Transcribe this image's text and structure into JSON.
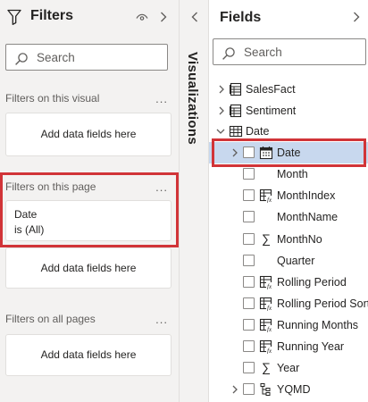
{
  "filters": {
    "title": "Filters",
    "search_placeholder": "Search",
    "this_visual": {
      "label": "Filters on this visual",
      "more": "...",
      "well": "Add data fields here"
    },
    "this_page": {
      "label": "Filters on this page",
      "more": "...",
      "card_field": "Date",
      "card_value": "is (All)",
      "well": "Add data fields here"
    },
    "all_pages": {
      "label": "Filters on all pages",
      "more": "...",
      "well": "Add data fields here"
    }
  },
  "visualizations": {
    "label": "Visualizations"
  },
  "fields": {
    "title": "Fields",
    "search_placeholder": "Search",
    "tables": [
      {
        "name": "SalesFact",
        "expanded": false,
        "icon": "table-icon"
      },
      {
        "name": "Sentiment",
        "expanded": false,
        "icon": "table-icon"
      },
      {
        "name": "Date",
        "expanded": true,
        "icon": "table-grid-icon"
      }
    ],
    "date_fields": [
      {
        "name": "Date",
        "icon": "calendar-hierarchy-icon",
        "expandable": true,
        "highlighted": true
      },
      {
        "name": "Month",
        "icon": "",
        "expandable": false
      },
      {
        "name": "MonthIndex",
        "icon": "calculated-column-icon",
        "expandable": false
      },
      {
        "name": "MonthName",
        "icon": "",
        "expandable": false
      },
      {
        "name": "MonthNo",
        "icon": "sigma-icon",
        "expandable": false
      },
      {
        "name": "Quarter",
        "icon": "",
        "expandable": false
      },
      {
        "name": "Rolling Period",
        "icon": "calculated-column-icon",
        "expandable": false
      },
      {
        "name": "Rolling Period Sort",
        "icon": "calculated-column-icon",
        "expandable": false
      },
      {
        "name": "Running Months",
        "icon": "calculated-column-icon",
        "expandable": false
      },
      {
        "name": "Running Year",
        "icon": "calculated-column-icon",
        "expandable": false
      },
      {
        "name": "Year",
        "icon": "sigma-icon",
        "expandable": false
      },
      {
        "name": "YQMD",
        "icon": "hierarchy-icon",
        "expandable": true
      }
    ]
  },
  "colors": {
    "highlight_border": "#d13438",
    "highlight_fill": "#c8d8ee",
    "pane_bg": "#f3f2f1"
  }
}
